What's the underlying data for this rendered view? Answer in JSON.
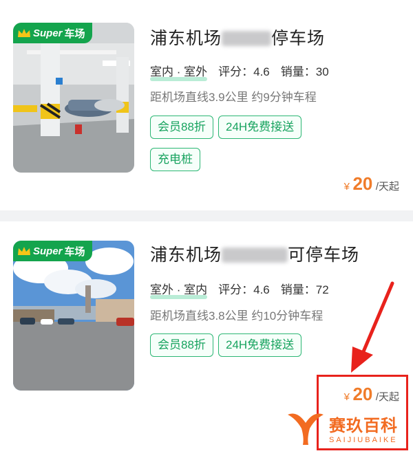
{
  "listings": [
    {
      "badge_brand": "Super",
      "badge_brand2": "车场",
      "title_prefix": "浦东机场",
      "title_suffix": "停车场",
      "location_type": "室内 · 室外",
      "rating": "评分：4.6",
      "sales": "销量：30",
      "distance": "距机场直线3.9公里 约9分钟车程",
      "tags": [
        "会员88折",
        "24H免费接送",
        "充电桩"
      ],
      "price": {
        "currency": "¥",
        "amount": "20",
        "unit": "/天起"
      }
    },
    {
      "badge_brand": "Super",
      "badge_brand2": "车场",
      "title_prefix": "浦东机场",
      "title_suffix": "可停车场",
      "location_type": "室外 · 室内",
      "rating": "评分：4.6",
      "sales": "销量：72",
      "distance": "距机场直线3.8公里 约10分钟车程",
      "tags": [
        "会员88折",
        "24H免费接送"
      ],
      "price": {
        "currency": "¥",
        "amount": "20",
        "unit": "/天起"
      }
    }
  ],
  "watermark": {
    "cn": "赛玖百科",
    "en": "SAIJIUBAIKE"
  },
  "colors": {
    "accent": "#14a44d",
    "price": "#f07c2a",
    "highlight": "#e8221c",
    "watermark": "#f26b21"
  }
}
